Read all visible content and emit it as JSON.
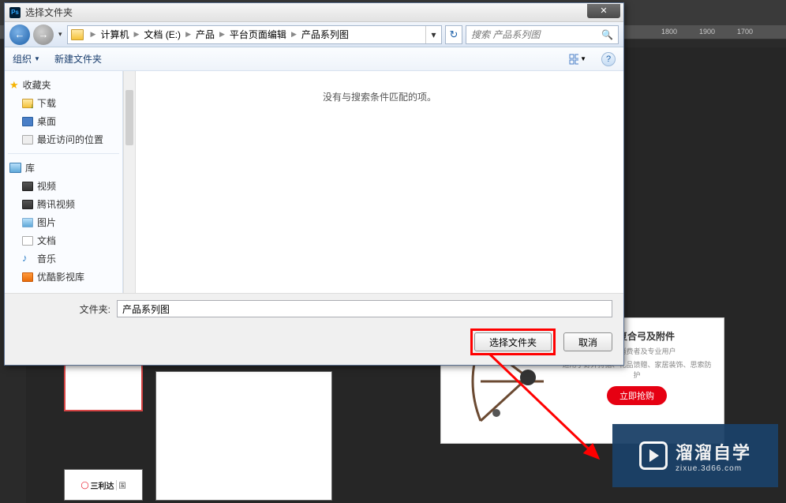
{
  "ruler_ticks": [
    {
      "pos": 842,
      "label": "1800"
    },
    {
      "pos": 888,
      "label": "1900"
    },
    {
      "pos": 934,
      "label": "1700"
    }
  ],
  "dialog": {
    "title": "选择文件夹",
    "close_glyph": "✕",
    "nav": {
      "back_glyph": "←",
      "fwd_glyph": "→",
      "refresh_glyph": "↻",
      "crumbs": [
        "计算机",
        "文档 (E:)",
        "产品",
        "平台页面编辑",
        "产品系列图"
      ],
      "search_placeholder": "搜索 产品系列图"
    },
    "toolbar": {
      "organize": "组织",
      "newfolder": "新建文件夹",
      "help_glyph": "?"
    },
    "sidebar": {
      "favorites": "收藏夹",
      "downloads": "下载",
      "desktop": "桌面",
      "recent": "最近访问的位置",
      "library": "库",
      "video": "视频",
      "tencent": "腾讯视频",
      "pictures": "图片",
      "documents": "文档",
      "music": "音乐",
      "youku": "优酷影视库"
    },
    "content": {
      "empty_msg": "没有与搜索条件匹配的项。"
    },
    "footer": {
      "label": "文件夹:",
      "value": "产品系列图",
      "select_btn": "选择文件夹",
      "cancel_btn": "取消"
    }
  },
  "product": {
    "title": "狩猎复合弓及附件",
    "sub1": "中高端消费者及专业用户",
    "sub2": "适用于野外狩猎、礼品馈赠、家居装饰、思索防护",
    "buy": "立即抢购"
  },
  "thumb2_logo": "三利达",
  "thumb2_sub": "国",
  "watermark": {
    "main": "溜溜自学",
    "sub": "zixue.3d66.com"
  }
}
